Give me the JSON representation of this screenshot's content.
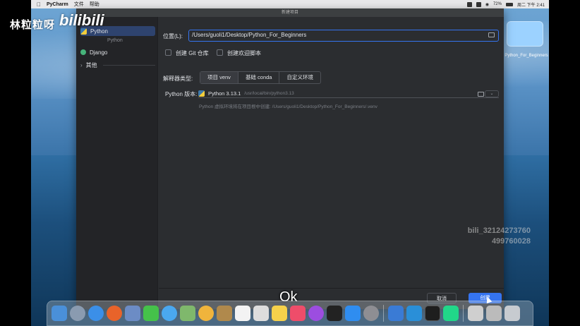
{
  "menubar": {
    "app_name": "PyCharm",
    "menus": [
      "文件",
      "帮助"
    ],
    "battery": "72%",
    "clock": "周二 下午 2:41"
  },
  "watermark": {
    "channel": "林粒粒呀",
    "logo": "bilibili",
    "id_line1": "bili_32124273760",
    "id_line2": "499760028"
  },
  "desktop": {
    "folder_label": "Python_For_Beginners"
  },
  "dialog": {
    "title": "新建项目",
    "sidebar": {
      "items": [
        {
          "label": "Python",
          "selected": true
        },
        {
          "label": "Django",
          "selected": false
        },
        {
          "label": "其他",
          "selected": false
        }
      ],
      "group_label": "Python"
    },
    "location": {
      "label": "位置(L):",
      "value": "/Users/guoli1/Desktop/Python_For_Beginners"
    },
    "create_git": "创建 Git 仓库",
    "create_welcome": "创建欢迎脚本",
    "interpreter_type": {
      "label": "解释器类型:",
      "options": [
        "项目 venv",
        "基础 conda",
        "自定义环境"
      ],
      "selected": "项目 venv"
    },
    "python_version": {
      "label": "Python 版本:",
      "value": "Python 3.13.1",
      "path": "/usr/local/bin/python3.13"
    },
    "venv_hint": "Python 虚拟环境将在项目根中创建: /Users/guoli1/Desktop/Python_For_Beginners/.venv",
    "buttons": {
      "cancel": "取消",
      "create": "创建"
    }
  },
  "subtitle": "Ok",
  "colors": {
    "accent": "#3574f0",
    "dialog_bg": "#2b2d30",
    "sidebar_bg": "#232427"
  }
}
